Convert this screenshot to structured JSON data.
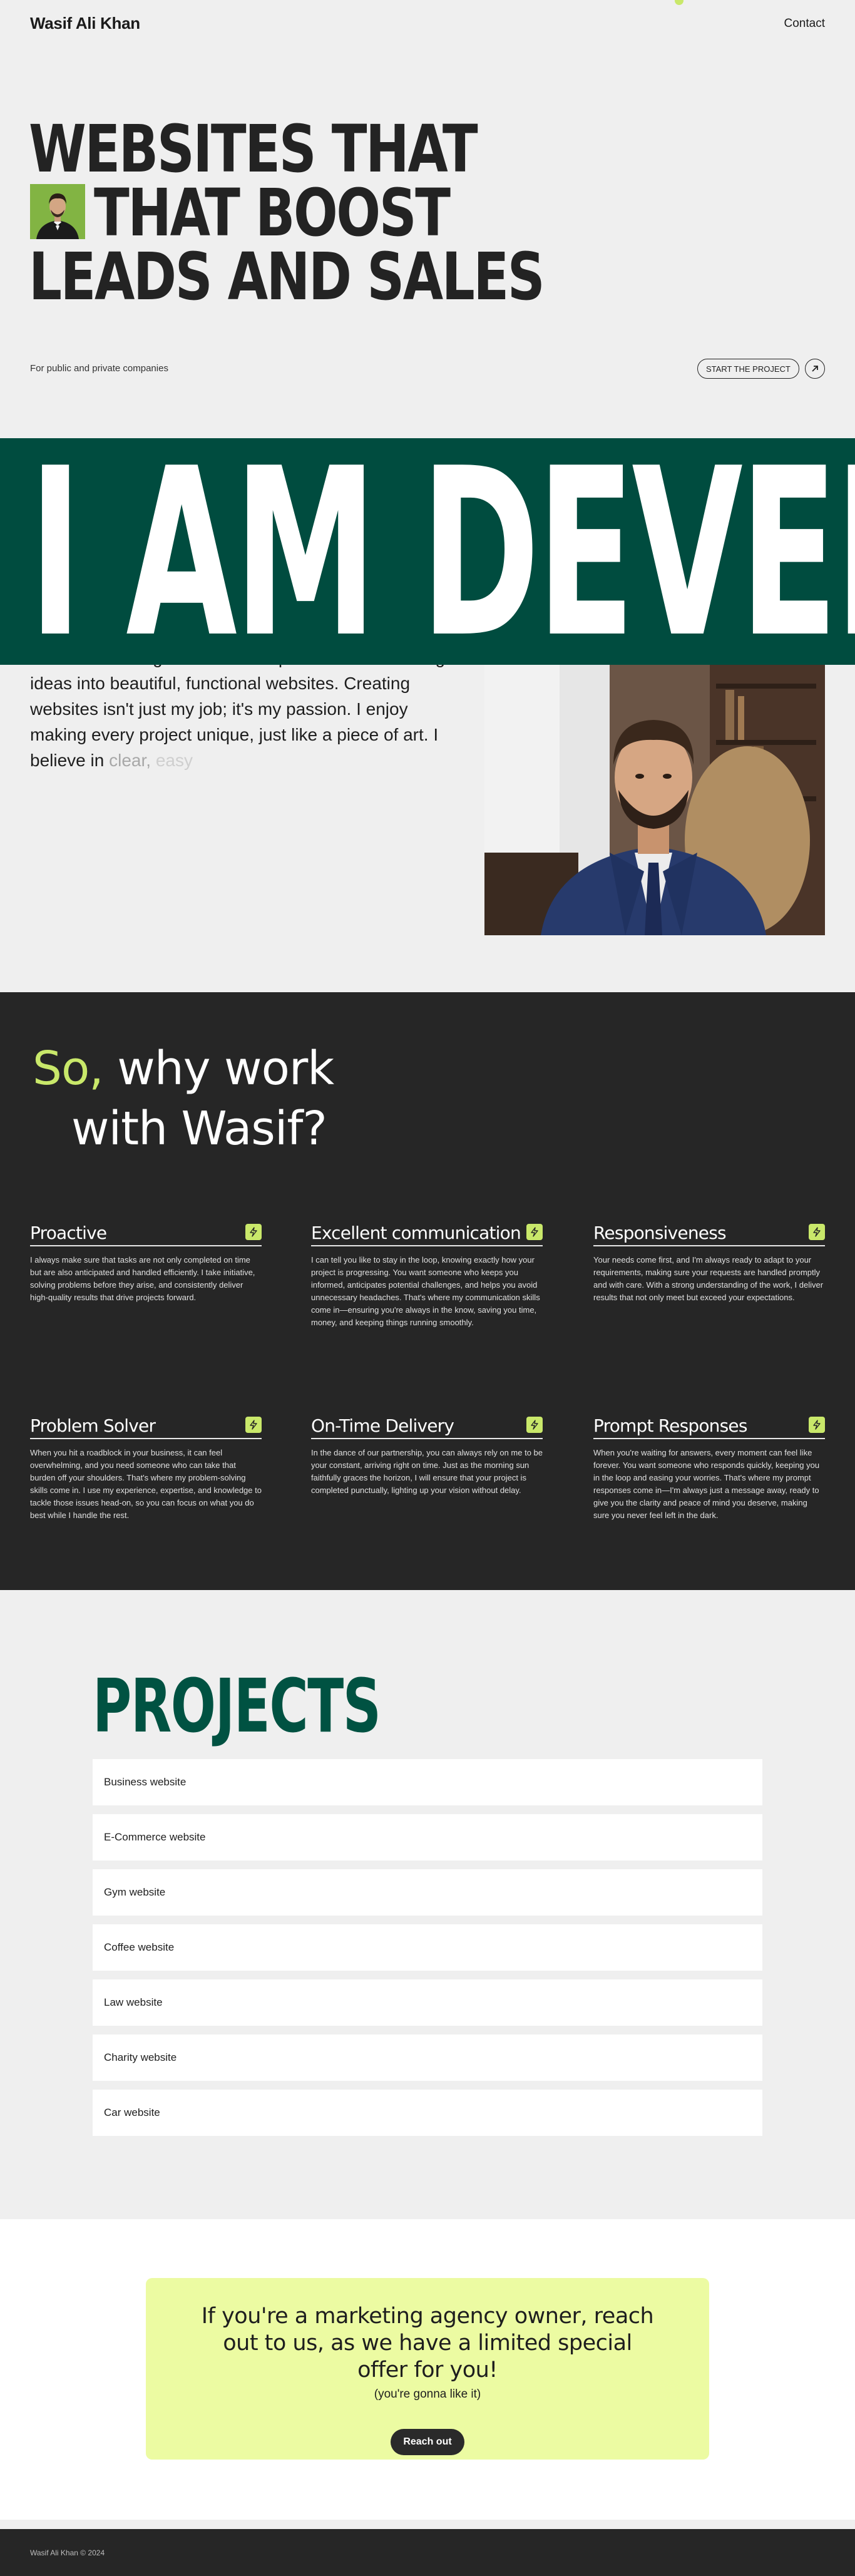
{
  "header": {
    "brand": "Wasif Ali Khan",
    "contact": "Contact"
  },
  "hero": {
    "line1": "WEBSITES THAT",
    "line2": "THAT BOOST",
    "line3": "LEADS AND SALES",
    "subtitle": "For public and private companies",
    "cta_label": "START THE PROJECT"
  },
  "banner": {
    "text": "I AM DEVELOP"
  },
  "about": {
    "text": "I am a web designer and developer who loves turning ideas into beautiful, functional websites. Creating websites isn't just my job; it's my passion. I enjoy making every project unique, just like a piece of art. I believe in",
    "fade1": "clear,",
    "fade2": "easy"
  },
  "why": {
    "title_accent": "So,",
    "title_rest": " why work",
    "title_line2": "with Wasif?",
    "features": [
      {
        "title": "Proactive",
        "body": "I always make sure that tasks are not only completed on time but are also anticipated and handled efficiently. I take initiative, solving problems before they arise, and consistently deliver high-quality results that drive projects forward."
      },
      {
        "title": "Excellent communication",
        "body": "I can tell you like to stay in the loop, knowing exactly how your project is progressing. You want someone who keeps you informed, anticipates potential challenges, and helps you avoid unnecessary headaches. That's where my communication skills come in—ensuring you're always in the know, saving you time, money, and keeping things running smoothly."
      },
      {
        "title": "Responsiveness",
        "body": "Your needs come first, and I'm always ready to adapt to your requirements, making sure your requests are handled promptly and with care. With a strong understanding of the work, I deliver results that not only meet but exceed your expectations."
      },
      {
        "title": "Problem Solver",
        "body": "When you hit a roadblock in your business, it can feel overwhelming, and you need someone who can take that burden off your shoulders. That's where my problem-solving skills come in. I use my experience, expertise, and knowledge to tackle those issues head-on, so you can focus on what you do best while I handle the rest."
      },
      {
        "title": "On-Time Delivery",
        "body": "In the dance of our partnership, you can always rely on me to be your constant, arriving right on time. Just as the morning sun faithfully graces the horizon, I will ensure that your project is completed punctually, lighting up your vision without delay."
      },
      {
        "title": "Prompt Responses",
        "body": "When you're waiting for answers, every moment can feel like forever. You want someone who responds quickly, keeping you in the loop and easing your worries. That's where my prompt responses come in—I'm always just a message away, ready to give you the clarity and peace of mind you deserve, making sure you never feel left in the dark."
      }
    ]
  },
  "projects": {
    "title": "PROJECTS",
    "items": [
      "Business website",
      "E-Commerce website",
      "Gym website",
      "Coffee website",
      "Law website",
      "Charity website",
      "Car website"
    ]
  },
  "cta": {
    "heading": "If you're a marketing agency owner, reach out to us, as we have a limited special offer for you!",
    "sub": "(you're gonna like it)",
    "button": "Reach out"
  },
  "footer": {
    "text": "Wasif Ali Khan © 2024"
  },
  "colors": {
    "accent": "#c9e86a",
    "brand_green": "#004c3f",
    "dark": "#262626",
    "cta_bg": "#ecfba2"
  },
  "icons": {
    "start_arrow": "arrow-up-right-icon",
    "feature": "lightning-bolt-icon"
  }
}
